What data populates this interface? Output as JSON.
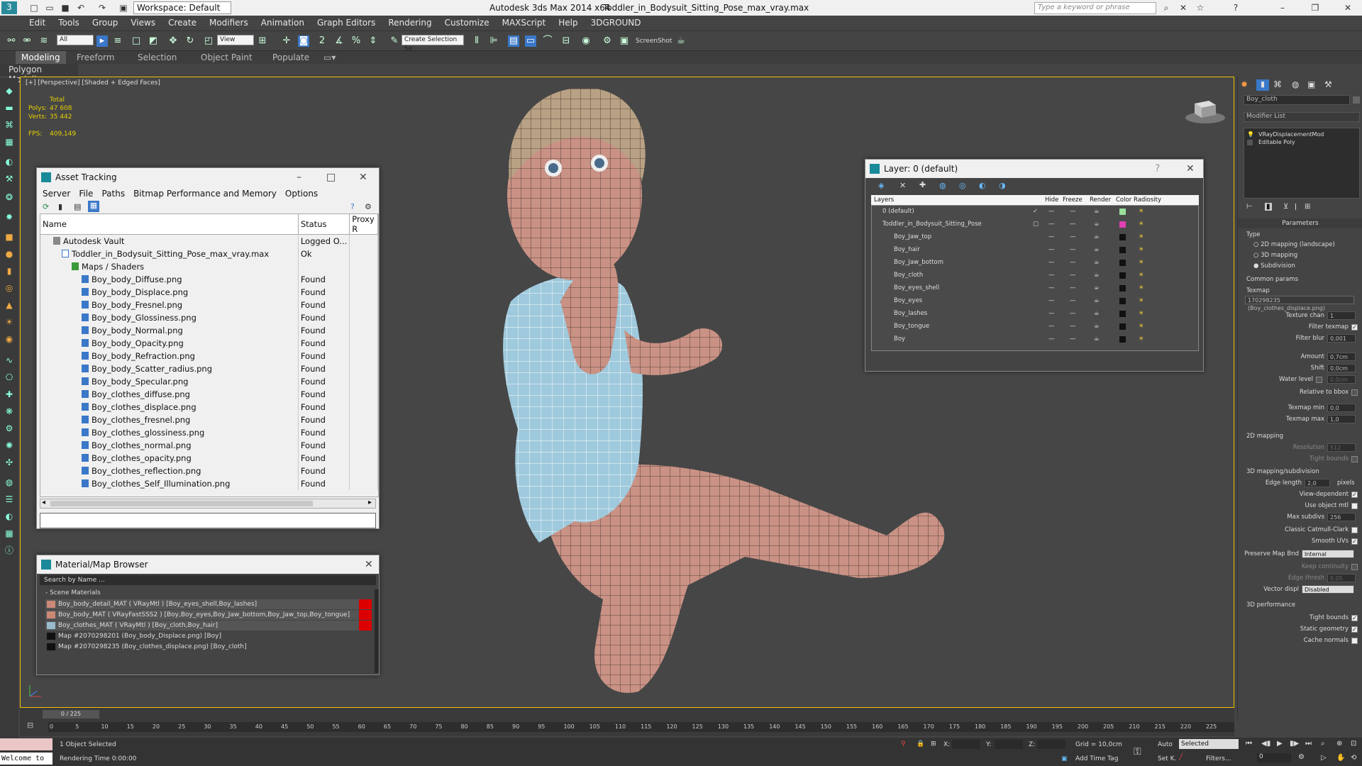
{
  "title": {
    "workspace": "Workspace: Default",
    "app": "Autodesk 3ds Max  2014 x64",
    "file": "Toddler_in_Bodysuit_Sitting_Pose_max_vray.max",
    "search_placeholder": "Type a keyword or phrase"
  },
  "menu": [
    "Edit",
    "Tools",
    "Group",
    "Views",
    "Create",
    "Modifiers",
    "Animation",
    "Graph Editors",
    "Rendering",
    "Customize",
    "MAXScript",
    "Help",
    "3DGROUND"
  ],
  "toolbar": {
    "filter": "All",
    "view": "View",
    "selection_set": "Create Selection Se",
    "screenshot": "ScreenShot"
  },
  "ribbon": {
    "tabs": [
      "Modeling",
      "Freeform",
      "Selection",
      "Object Paint",
      "Populate"
    ],
    "sub": "Polygon Modeling"
  },
  "viewport": {
    "label": "[+] [Perspective] [Shaded + Edged Faces]",
    "total": "Total",
    "polys_label": "Polys:",
    "polys": "47 608",
    "verts_label": "Verts:",
    "verts": "35 442",
    "fps_label": "FPS:",
    "fps": "409,149"
  },
  "asset": {
    "title": "Asset Tracking",
    "menu": [
      "Server",
      "File",
      "Paths",
      "Bitmap Performance and Memory",
      "Options"
    ],
    "columns": [
      "Name",
      "Status",
      "Proxy R"
    ],
    "rows": [
      {
        "name": "Autodesk Vault",
        "status": "Logged O..."
      },
      {
        "name": "Toddler_in_Bodysuit_Sitting_Pose_max_vray.max",
        "status": "Ok"
      },
      {
        "name": "Maps / Shaders",
        "status": ""
      },
      {
        "name": "Boy_body_Diffuse.png",
        "status": "Found"
      },
      {
        "name": "Boy_body_Displace.png",
        "status": "Found"
      },
      {
        "name": "Boy_body_Fresnel.png",
        "status": "Found"
      },
      {
        "name": "Boy_body_Glossiness.png",
        "status": "Found"
      },
      {
        "name": "Boy_body_Normal.png",
        "status": "Found"
      },
      {
        "name": "Boy_body_Opacity.png",
        "status": "Found"
      },
      {
        "name": "Boy_body_Refraction.png",
        "status": "Found"
      },
      {
        "name": "Boy_body_Scatter_radius.png",
        "status": "Found"
      },
      {
        "name": "Boy_body_Specular.png",
        "status": "Found"
      },
      {
        "name": "Boy_clothes_diffuse.png",
        "status": "Found"
      },
      {
        "name": "Boy_clothes_displace.png",
        "status": "Found"
      },
      {
        "name": "Boy_clothes_fresnel.png",
        "status": "Found"
      },
      {
        "name": "Boy_clothes_glossiness.png",
        "status": "Found"
      },
      {
        "name": "Boy_clothes_normal.png",
        "status": "Found"
      },
      {
        "name": "Boy_clothes_opacity.png",
        "status": "Found"
      },
      {
        "name": "Boy_clothes_reflection.png",
        "status": "Found"
      },
      {
        "name": "Boy_clothes_Self_Illumination.png",
        "status": "Found"
      }
    ]
  },
  "matbrowser": {
    "title": "Material/Map Browser",
    "search": "Search by Name ...",
    "group": "- Scene Materials",
    "items": [
      "Boy_body_detail_MAT ( VRayMtl ) [Boy_eyes_shell,Boy_lashes]",
      "Boy_body_MAT ( VRayFastSSS2 ) [Boy,Boy_eyes,Boy_Jaw_bottom,Boy_Jaw_top,Boy_tongue]",
      "Boy_clothes_MAT ( VRayMtl ) [Boy_cloth,Boy_hair]",
      "Map #2070298201 (Boy_body_Displace.png) [Boy]",
      "Map #2070298235 (Boy_clothes_displace.png) [Boy_cloth]"
    ]
  },
  "layer": {
    "title": "Layer: 0 (default)",
    "columns": [
      "Layers",
      "Hide",
      "Freeze",
      "Render",
      "Color",
      "Radiosity"
    ],
    "rows": [
      {
        "name": "0 (default)",
        "color": "#9adf9a"
      },
      {
        "name": "Toddler_in_Bodysuit_Sitting_Pose",
        "color": "#e040b0"
      },
      {
        "name": "Boy_Jaw_top",
        "color": "#111111"
      },
      {
        "name": "Boy_hair",
        "color": "#111111"
      },
      {
        "name": "Boy_Jaw_bottom",
        "color": "#111111"
      },
      {
        "name": "Boy_cloth",
        "color": "#111111"
      },
      {
        "name": "Boy_eyes_shell",
        "color": "#111111"
      },
      {
        "name": "Boy_eyes",
        "color": "#111111"
      },
      {
        "name": "Boy_lashes",
        "color": "#111111"
      },
      {
        "name": "Boy_tongue",
        "color": "#111111"
      },
      {
        "name": "Boy",
        "color": "#111111"
      }
    ]
  },
  "rpanel": {
    "object": "Boy_cloth",
    "modifier_list": "Modifier List",
    "stack": [
      "VRayDisplacementMod",
      "Editable Poly"
    ],
    "parameters": "Parameters",
    "type": "Type",
    "types": [
      "2D mapping (landscape)",
      "3D mapping",
      "Subdivision"
    ],
    "common": "Common params",
    "texmap": "Texmap",
    "texmap_val": "170298235 (Boy_clothes_displace.png)",
    "fields": [
      {
        "label": "Texture chan",
        "value": "1"
      },
      {
        "label": "Filter texmap",
        "value": ""
      },
      {
        "label": "Filter blur",
        "value": "0,001"
      },
      {
        "label": "Amount",
        "value": "0,7cm"
      },
      {
        "label": "Shift",
        "value": "0,0cm"
      },
      {
        "label": "Water level",
        "value": "0,0cm"
      },
      {
        "label": "Relative to bbox",
        "value": ""
      },
      {
        "label": "Texmap min",
        "value": "0,0"
      },
      {
        "label": "Texmap max",
        "value": "1,0"
      }
    ],
    "mapping2d": "2D mapping",
    "resolution": "Resolution",
    "resolution_val": "512",
    "tight": "Tight bounds",
    "mapping3d": "3D mapping/subdivision",
    "edge_length": "Edge length",
    "edge_val": "2,0",
    "pixels": "pixels",
    "view_dep": "View-dependent",
    "use_obj": "Use object mtl",
    "max_subdivs": "Max subdivs",
    "max_subdivs_val": "256",
    "classic": "Classic Catmull-Clark",
    "smooth": "Smooth UVs",
    "preserve": "Preserve Map Bnd",
    "preserve_val": "Internal",
    "keep": "Keep continuity",
    "edge_thresh": "Edge thresh",
    "edge_thresh_val": "0,05",
    "vector": "Vector displ",
    "vector_val": "Disabled",
    "perf": "3D performance",
    "perf_items": [
      "Tight bounds",
      "Static geometry",
      "Cache normals"
    ]
  },
  "timeline": {
    "frame": "0 / 225",
    "ticks": [
      "0",
      "5",
      "10",
      "15",
      "20",
      "25",
      "30",
      "35",
      "40",
      "45",
      "50",
      "55",
      "60",
      "65",
      "70",
      "75",
      "80",
      "85",
      "90",
      "95",
      "100",
      "105",
      "110",
      "115",
      "120",
      "125",
      "130",
      "135",
      "140",
      "145",
      "150",
      "155",
      "160",
      "165",
      "170",
      "175",
      "180",
      "185",
      "190",
      "195",
      "200",
      "205",
      "210",
      "215",
      "220",
      "225"
    ]
  },
  "status": {
    "welcome": "Welcome to",
    "selected": "1 Object Selected",
    "render_time": "Rendering Time  0:00:00",
    "x": "X:",
    "y": "Y:",
    "z": "Z:",
    "grid": "Grid = 10,0cm",
    "add_tag": "Add Time Tag",
    "auto": "Auto",
    "set_key": "Set K.",
    "sel_dropdown": "Selected",
    "filters": "Filters...",
    "frame": "0"
  }
}
